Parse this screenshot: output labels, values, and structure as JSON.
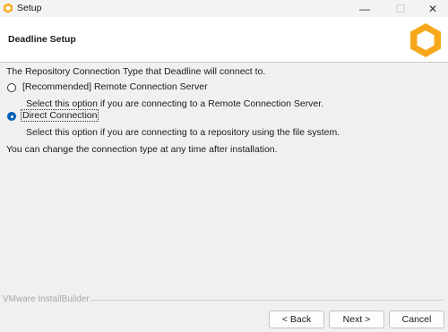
{
  "window": {
    "title": "Setup",
    "controls": {
      "minimize": "—",
      "maximize": "☐",
      "close": "✕"
    }
  },
  "header": {
    "title": "Deadline Setup",
    "logo_icon": "deadline-hexagon-logo",
    "accent": "#f7a81b"
  },
  "content": {
    "intro": "The Repository Connection Type that Deadline will connect to.",
    "options": [
      {
        "label": "[Recommended] Remote Connection Server",
        "description": "Select this option if you are connecting to a Remote Connection Server.",
        "selected": false
      },
      {
        "label": "Direct Connection",
        "description": "Select this option if you are connecting to a repository using the file system.",
        "selected": true
      }
    ],
    "note": "You can change the connection type at any time after installation."
  },
  "footer": {
    "brand": "VMware InstallBuilder",
    "buttons": {
      "back": "< Back",
      "next": "Next >",
      "cancel": "Cancel"
    }
  },
  "colors": {
    "radio_selected": "#005fb8"
  }
}
